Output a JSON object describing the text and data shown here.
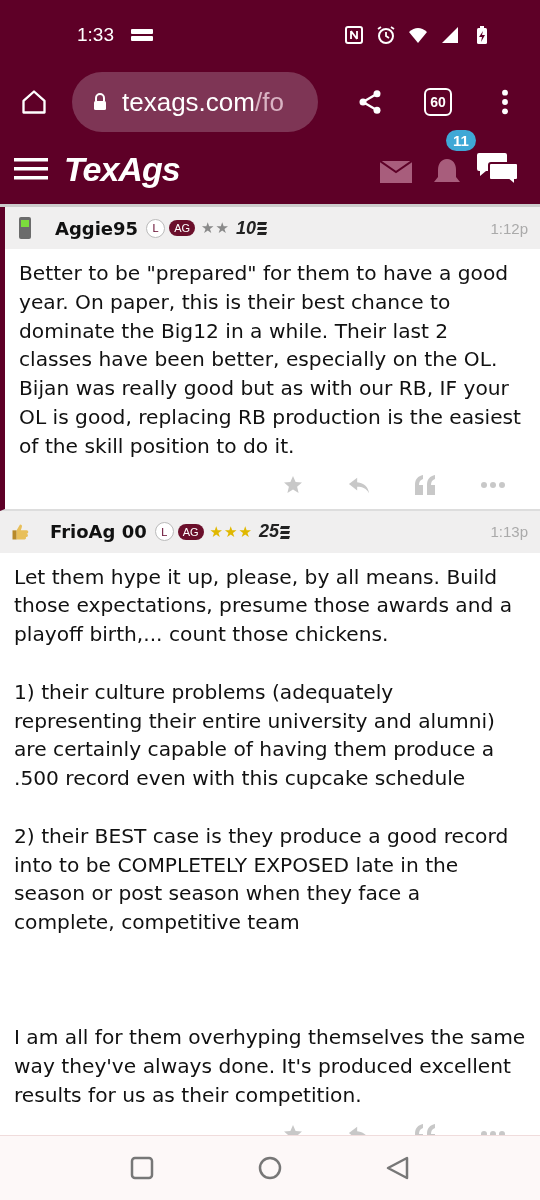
{
  "status_bar": {
    "time": "1:33"
  },
  "browser": {
    "url_host": "texags.com",
    "url_path": "/fo",
    "tab_count": "60"
  },
  "site_header": {
    "logo": "TexAgs",
    "notification_count": "11"
  },
  "posts": [
    {
      "author": "Aggie95",
      "avatar": {
        "kind": "phone"
      },
      "first": true,
      "badge_l": "L",
      "badge_ag": "AG",
      "rank": "★★",
      "color": "#8a8a8a",
      "years": "10",
      "time": "1:12p",
      "paragraphs": [
        {
          "text": "Better to be \"prepared\" for them to have a good year. On paper, this is their best chance to dominate the Big12 in a while. Their last 2 classes have been better, especially on the OL. Bijan was really good but as with our RB, IF your OL is good, replacing RB production is the easiest of the skill position to do it.",
          "spaced": false
        }
      ]
    },
    {
      "author": "FrioAg 00",
      "avatar": {
        "kind": "thumb"
      },
      "first": false,
      "badge_l": "L",
      "badge_ag": "AG",
      "rank": "★★★",
      "color": "#e0b800",
      "years": "25",
      "time": "1:13p",
      "paragraphs": [
        {
          "text": "Let them hype it up, please, by all means. Build those expectations, presume those awards and a playoff birth,... count those chickens.",
          "spaced": false
        },
        {
          "text": "1) their culture problems (adequately representing their entire university and alumni) are certainly capable of having them produce a .500 record even with this cupcake schedule",
          "spaced": false
        },
        {
          "text": "2) their BEST case is they produce a good record into to be COMPLETELY EXPOSED late in the season or post season when they face a complete, competitive team",
          "spaced": false
        },
        {
          "text": "I am all for them overhyping themselves the same way they've always done. It's produced excellent results for us as their competition.",
          "spaced": true
        }
      ]
    }
  ]
}
